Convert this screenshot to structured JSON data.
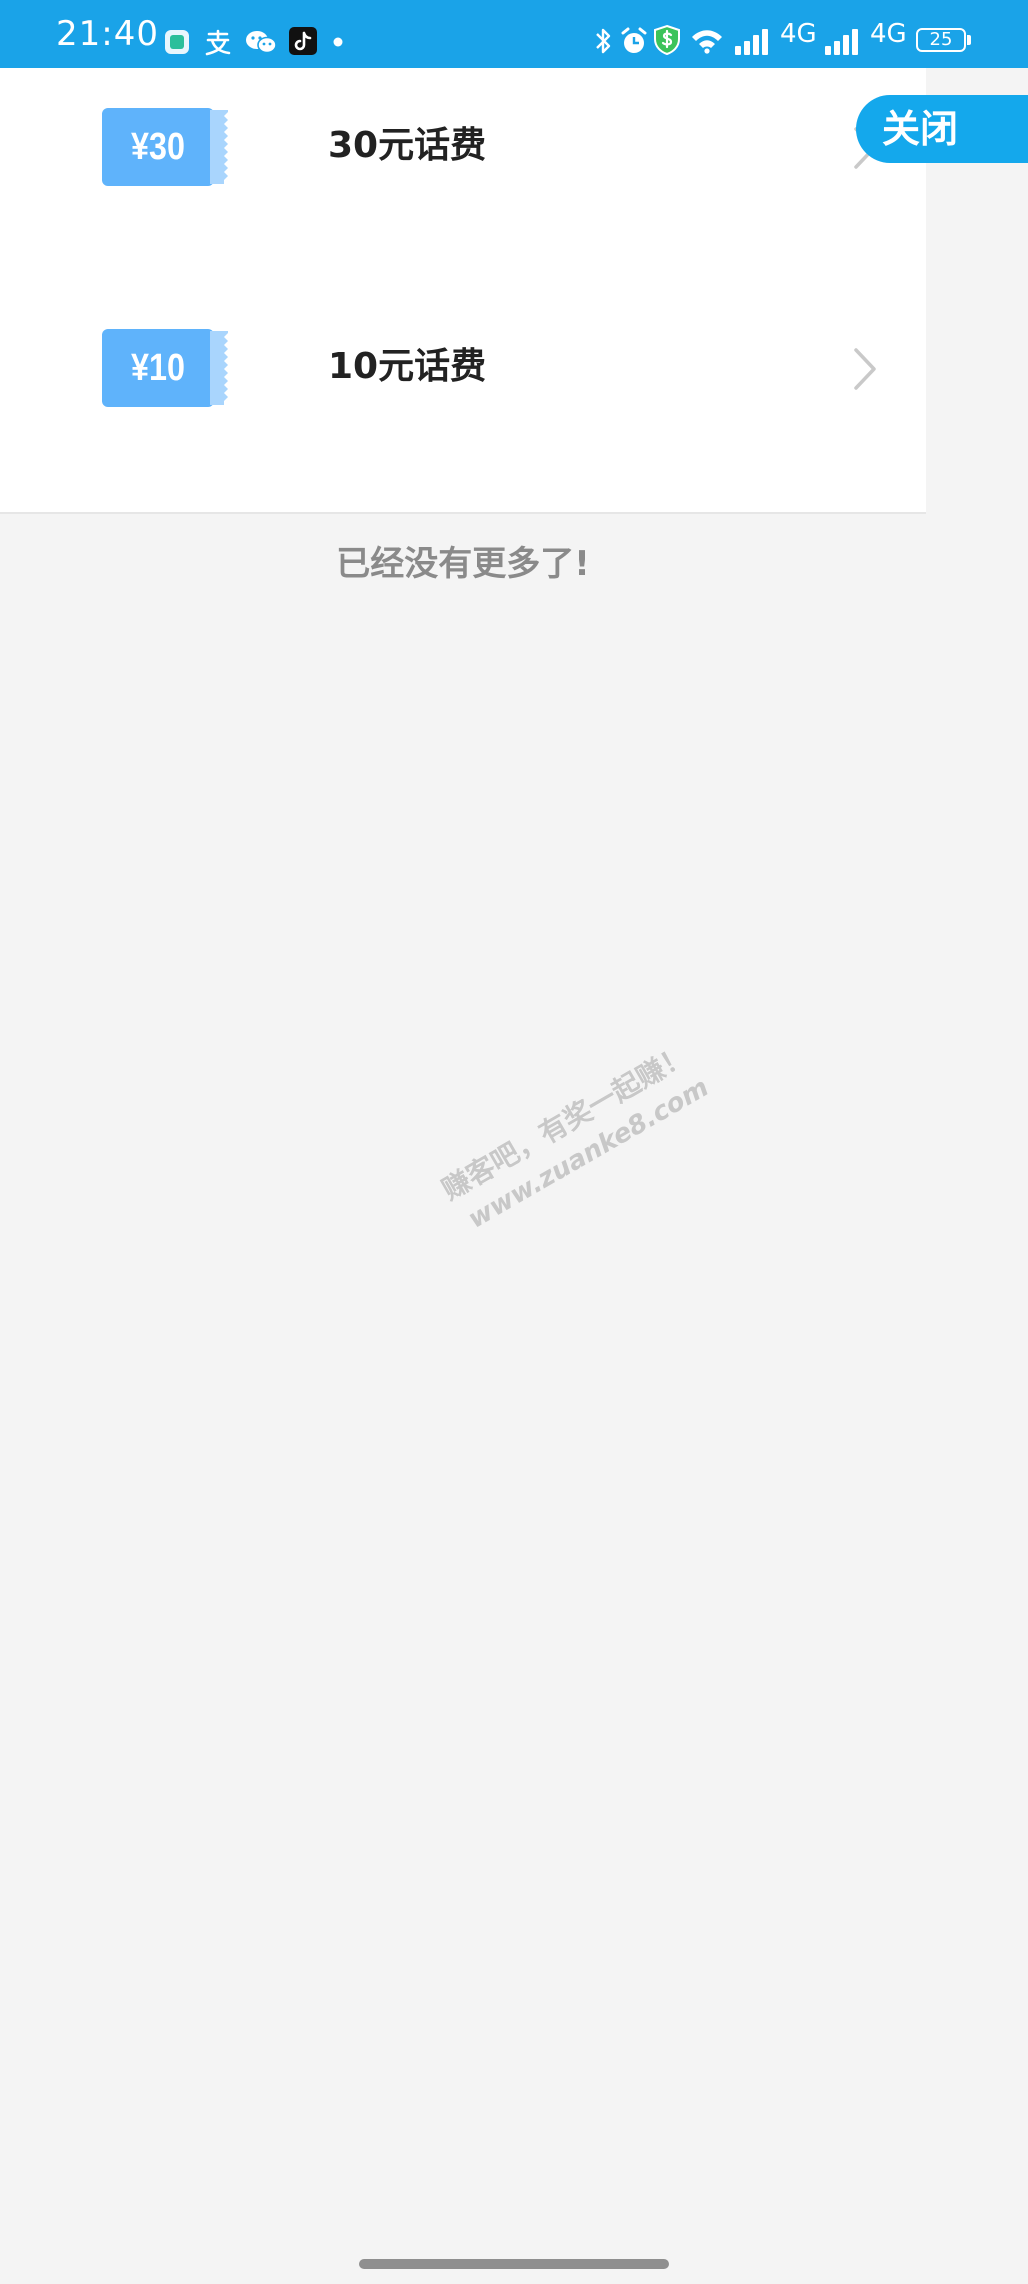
{
  "status_bar": {
    "time": "21:40",
    "left_icons": [
      "notes-app-icon",
      "alipay-icon",
      "wechat-icon",
      "tiktok-icon",
      "more-dot-icon"
    ],
    "right_icons": [
      "bluetooth-icon",
      "alarm-icon",
      "security-shield-icon",
      "wifi-icon",
      "signal-icon",
      "signal-icon"
    ],
    "network_1": "4G",
    "network_2": "4G",
    "battery_level": "25",
    "colors": {
      "background": "#1aa3e8",
      "foreground": "#ffffff"
    }
  },
  "close_button": {
    "label": "关闭",
    "color": "#14a8ec"
  },
  "coupons": [
    {
      "amount": "¥30",
      "label": "30元话费",
      "icon": "coupon-ticket-icon"
    },
    {
      "amount": "¥10",
      "label": "10元话费",
      "icon": "coupon-ticket-icon"
    }
  ],
  "list_end_text": "已经没有更多了!",
  "watermark": {
    "line1": "赚客吧，有奖一起赚！",
    "line2": "www.zuanke8.com"
  },
  "colors": {
    "coupon_blue": "#5fb3fb",
    "page_background": "#f4f4f4",
    "card_background": "#ffffff",
    "muted_text": "#8a8a8a"
  }
}
